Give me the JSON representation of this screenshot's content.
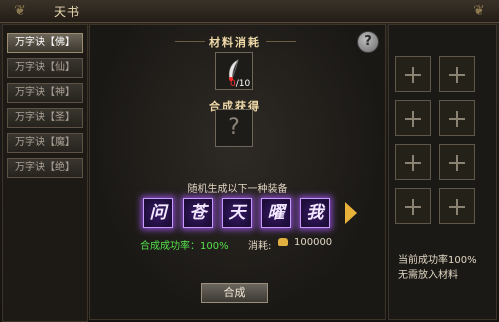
{
  "window": {
    "title": "天书"
  },
  "tabs": [
    {
      "label": "万字诀【佛】",
      "active": true
    },
    {
      "label": "万字诀【仙】",
      "active": false
    },
    {
      "label": "万字诀【神】",
      "active": false
    },
    {
      "label": "万字诀【圣】",
      "active": false
    },
    {
      "label": "万字诀【魔】",
      "active": false
    },
    {
      "label": "万字诀【绝】",
      "active": false
    }
  ],
  "center": {
    "materials_title": "材料消耗",
    "material_count_have": "0",
    "material_count_need": "/10",
    "result_title": "合成获得",
    "result_unknown": "?",
    "generate_text": "随机生成以下一种装备",
    "equipment": [
      "问",
      "苍",
      "天",
      "曜",
      "我"
    ],
    "success_rate": "合成成功率：100%",
    "cost_label": "消耗:",
    "cost_value": "100000",
    "craft_button": "合成",
    "help_icon": "?"
  },
  "right": {
    "material_slots": 8,
    "current_rate": "当前成功率100%",
    "no_material": "无需放入材料"
  },
  "colors": {
    "equipment_glow": "#aa5aff",
    "success_green": "#54e04a",
    "gold": "#e2b040"
  }
}
